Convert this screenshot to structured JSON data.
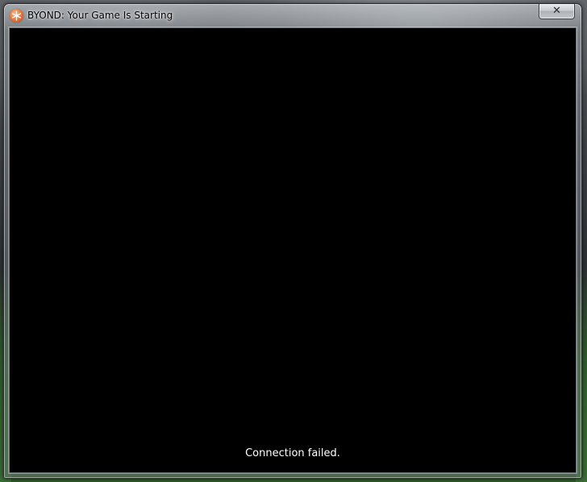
{
  "window": {
    "title": "BYOND: Your Game Is Starting",
    "icon": "byond-logo-icon",
    "close_label": "✕"
  },
  "content": {
    "status_text": "Connection failed."
  },
  "colors": {
    "content_background": "#000000",
    "status_text": "#ffffff",
    "icon_accent": "#e2733a"
  }
}
